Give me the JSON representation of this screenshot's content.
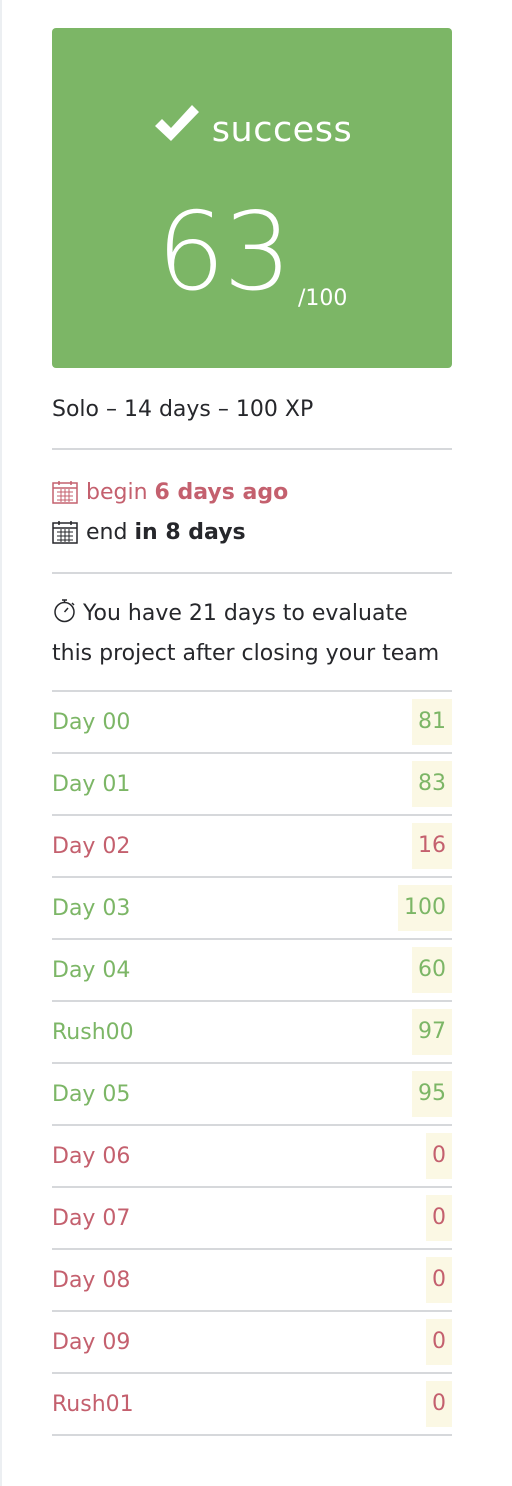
{
  "result": {
    "status": "success",
    "score": "63",
    "max": "/100",
    "color": "#7cb666"
  },
  "meta": "Solo – 14 days – 100 XP",
  "dates": {
    "begin_label": "begin",
    "begin_value": "6 days ago",
    "end_label": "end",
    "end_value": "in 8 days"
  },
  "evaluation_note": "You have 21 days to evaluate this project after closing your team",
  "modules": [
    {
      "name": "Day 00",
      "score": "81",
      "status": "passed"
    },
    {
      "name": "Day 01",
      "score": "83",
      "status": "passed"
    },
    {
      "name": "Day 02",
      "score": "16",
      "status": "failed"
    },
    {
      "name": "Day 03",
      "score": "100",
      "status": "passed"
    },
    {
      "name": "Day 04",
      "score": "60",
      "status": "passed"
    },
    {
      "name": "Rush00",
      "score": "97",
      "status": "passed"
    },
    {
      "name": "Day 05",
      "score": "95",
      "status": "passed"
    },
    {
      "name": "Day 06",
      "score": "0",
      "status": "failed"
    },
    {
      "name": "Day 07",
      "score": "0",
      "status": "failed"
    },
    {
      "name": "Day 08",
      "score": "0",
      "status": "failed"
    },
    {
      "name": "Day 09",
      "score": "0",
      "status": "failed"
    },
    {
      "name": "Rush01",
      "score": "0",
      "status": "failed"
    }
  ],
  "colors": {
    "success": "#7cb666",
    "fail": "#c4606e",
    "score_background": "#fbf8e4"
  },
  "icons": {
    "status": "check-icon",
    "begin": "calendar-icon",
    "end": "calendar-icon",
    "evaluation": "stopwatch-icon"
  }
}
